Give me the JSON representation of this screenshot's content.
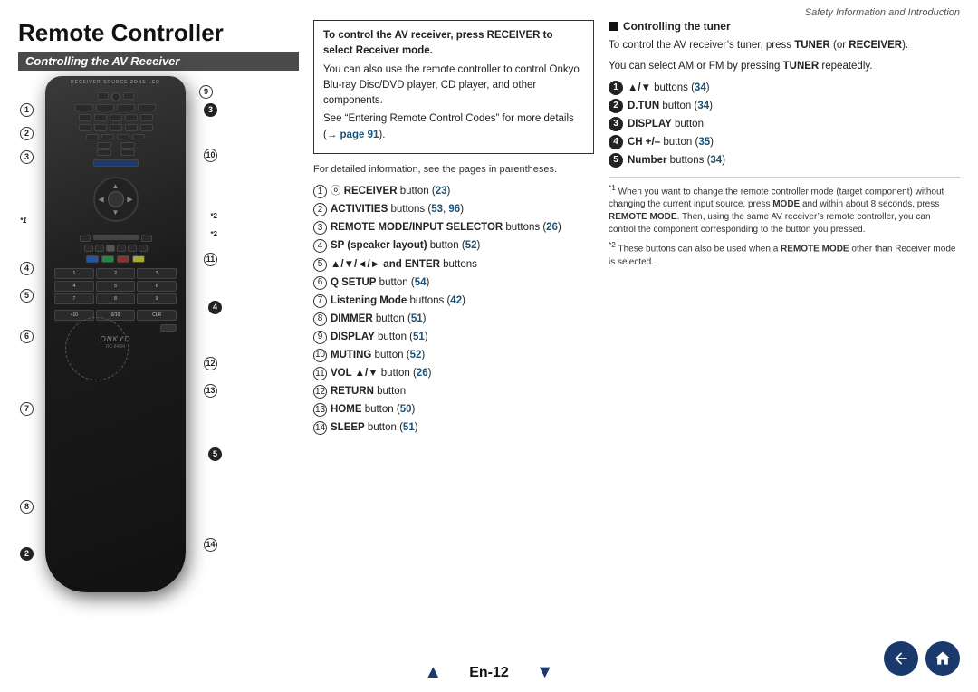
{
  "header": {
    "page_info": "Safety Information and Introduction"
  },
  "page_title": "Remote Controller",
  "section_title": "Controlling the AV Receiver",
  "info_box": {
    "line1": "To control the AV receiver, press RECEIVER to select Receiver mode.",
    "line2": "You can also use the remote controller to control Onkyo Blu-ray Disc/DVD player, CD player, and other components.",
    "line3": "See “Entering Remote Control Codes” for more details (→ page 91)."
  },
  "detail_text": "For detailed information, see the pages in parentheses.",
  "items": [
    {
      "num": "1",
      "text": " RECEIVER button (23)",
      "bold_part": "RECEIVER"
    },
    {
      "num": "2",
      "text": "ACTIVITIES buttons (53, 96)",
      "bold_part": "ACTIVITIES"
    },
    {
      "num": "3",
      "text": "REMOTE MODE/INPUT SELECTOR buttons (26)",
      "bold_part": "REMOTE MODE/INPUT SELECTOR"
    },
    {
      "num": "4",
      "text": "SP (speaker layout) button (52)",
      "bold_part": "SP (speaker layout)"
    },
    {
      "num": "5",
      "text": "▲/▼/◄/► and ENTER buttons",
      "bold_part": "▲/▼/◄/►"
    },
    {
      "num": "6",
      "text": "Q SETUP button (54)",
      "bold_part": "Q SETUP"
    },
    {
      "num": "7",
      "text": "Listening Mode buttons (42)",
      "bold_part": "Listening Mode"
    },
    {
      "num": "8",
      "text": "DIMMER button (51)",
      "bold_part": "DIMMER"
    },
    {
      "num": "9",
      "text": "DISPLAY button (51)",
      "bold_part": "DISPLAY"
    },
    {
      "num": "10",
      "text": "MUTING button (52)",
      "bold_part": "MUTING"
    },
    {
      "num": "11",
      "text": "VOL ▲/▼ button (26)",
      "bold_part": "VOL ▲/▼"
    },
    {
      "num": "12",
      "text": "RETURN button",
      "bold_part": "RETURN"
    },
    {
      "num": "13",
      "text": "HOME button (50)",
      "bold_part": "HOME"
    },
    {
      "num": "14",
      "text": "SLEEP button (51)",
      "bold_part": "SLEEP"
    }
  ],
  "tuner_section": {
    "header": "Controlling the tuner",
    "text1": "To control the AV receiver’s tuner, press TUNER (or RECEIVER).",
    "text2": "You can select AM or FM by pressing TUNER repeatedly.",
    "items": [
      {
        "num": "1",
        "text": "▲/▼ buttons (34)"
      },
      {
        "num": "2",
        "text": "D.TUN button (34)"
      },
      {
        "num": "3",
        "text": "DISPLAY button"
      },
      {
        "num": "4",
        "text": "CH +/– button (35)"
      },
      {
        "num": "5",
        "text": "Number buttons (34)"
      }
    ]
  },
  "footnotes": {
    "fn1_marker": "*1",
    "fn1_text": "When you want to change the remote controller mode (target component) without changing the current input source, press MODE and within about 8 seconds, press REMOTE MODE. Then, using the same AV receiver’s remote controller, you can control the component corresponding to the button you pressed.",
    "fn2_marker": "*2",
    "fn2_text": "These buttons can also be used when a REMOTE MODE other than Receiver mode is selected."
  },
  "footer": {
    "page": "En-12",
    "prev_arrow": "▲",
    "next_arrow": "▼"
  },
  "remote": {
    "model": "RC-840M",
    "brand": "ONKYO"
  }
}
